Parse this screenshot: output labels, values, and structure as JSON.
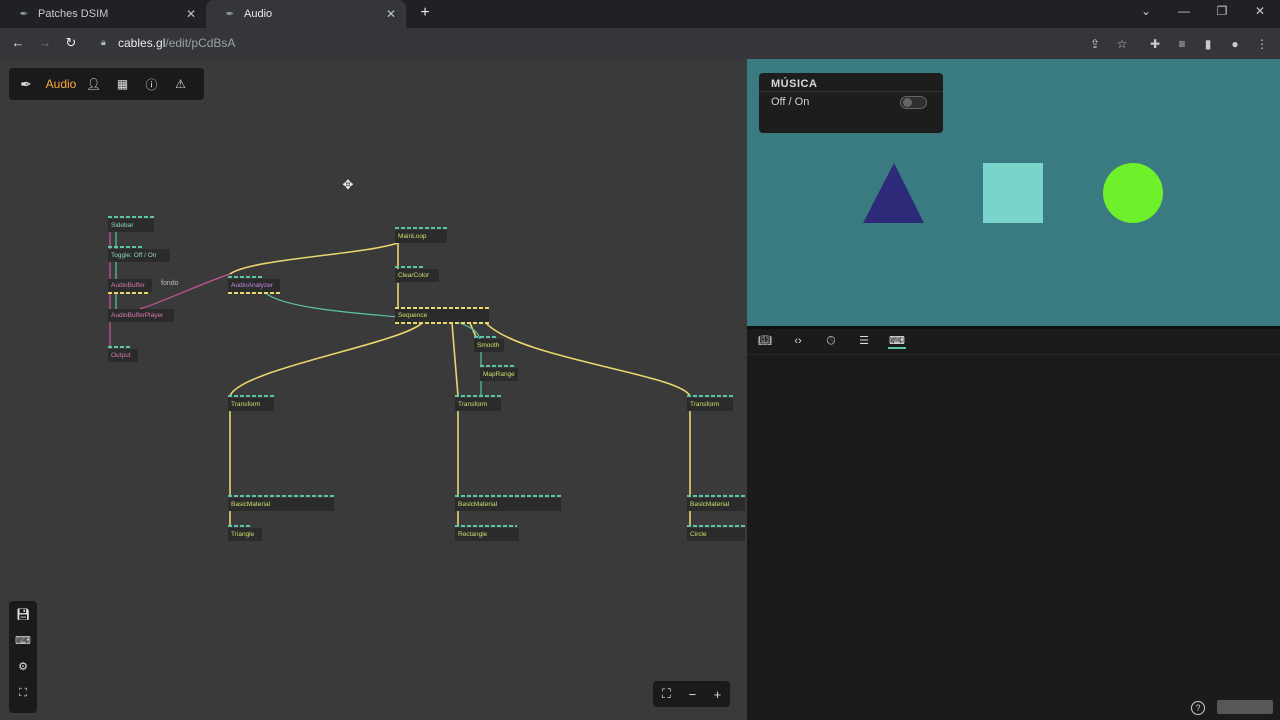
{
  "browser": {
    "tabs": [
      {
        "title": "Patches DSIM",
        "active": false
      },
      {
        "title": "Audio",
        "active": true
      }
    ],
    "url_host": "cables.gl",
    "url_path": "/edit/pCdBsA"
  },
  "editor": {
    "menu_title": "Audio",
    "ops": {
      "sidebar": "Sidebar",
      "toggle": "Toggle: Off / On",
      "audiobuffer": "AudioBuffer",
      "audiobufferplayer": "AudioBufferPlayer",
      "output": "Output",
      "audioanalyzer": "AudioAnalyzer",
      "mainloop": "MainLoop",
      "clearcolor": "ClearColor",
      "sequence": "Sequence",
      "smooth": "Smooth",
      "maprange": "MapRange",
      "transform1": "Transform",
      "transform2": "Transform",
      "transform3": "Transform",
      "basicmaterial1": "BasicMaterial",
      "basicmaterial2": "BasicMaterial",
      "basicmaterial3": "BasicMaterial",
      "triangle": "Triangle",
      "rectangle": "Rectangle",
      "circle": "Circle"
    },
    "comment_fondo": "fondo"
  },
  "canvas": {
    "gui_title": "MÚSICA",
    "gui_toggle_label": "Off / On",
    "toggle_on": false,
    "colors": {
      "background": "#3a7b81",
      "triangle": "#2e2a7a",
      "square": "#79d4cc",
      "circle": "#6ef02a"
    }
  }
}
